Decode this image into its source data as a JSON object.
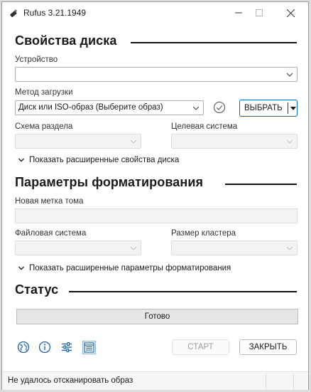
{
  "window": {
    "title": "Rufus 3.21.1949"
  },
  "drive_properties": {
    "heading": "Свойства диска",
    "device_label": "Устройство",
    "device_value": "",
    "boot_selection_label": "Метод загрузки",
    "boot_selection_value": "Диск или ISO-образ (Выберите образ)",
    "select_button_label": "ВЫБРАТЬ",
    "partition_scheme_label": "Схема раздела",
    "partition_scheme_value": "",
    "target_system_label": "Целевая система",
    "target_system_value": "",
    "advanced_toggle_label": "Показать расширенные свойства диска"
  },
  "format_options": {
    "heading": "Параметры форматирования",
    "volume_label_label": "Новая метка тома",
    "volume_label_value": "",
    "file_system_label": "Файловая система",
    "file_system_value": "",
    "cluster_size_label": "Размер кластера",
    "cluster_size_value": "",
    "advanced_toggle_label": "Показать расширенные параметры форматирования"
  },
  "status": {
    "heading": "Статус",
    "progress_text": "Готово",
    "progress_fraction": 0
  },
  "toolbar": {
    "icons": [
      "globe-icon",
      "info-icon",
      "settings-sliders-icon",
      "log-icon"
    ],
    "start_label": "СТАРТ",
    "close_label": "ЗАКРЫТЬ"
  },
  "statusbar": {
    "text": "Не удалось отсканировать образ"
  },
  "colors": {
    "accent": "#0067c0",
    "icon_blue": "#1a5fa8",
    "rule": "#111111"
  }
}
